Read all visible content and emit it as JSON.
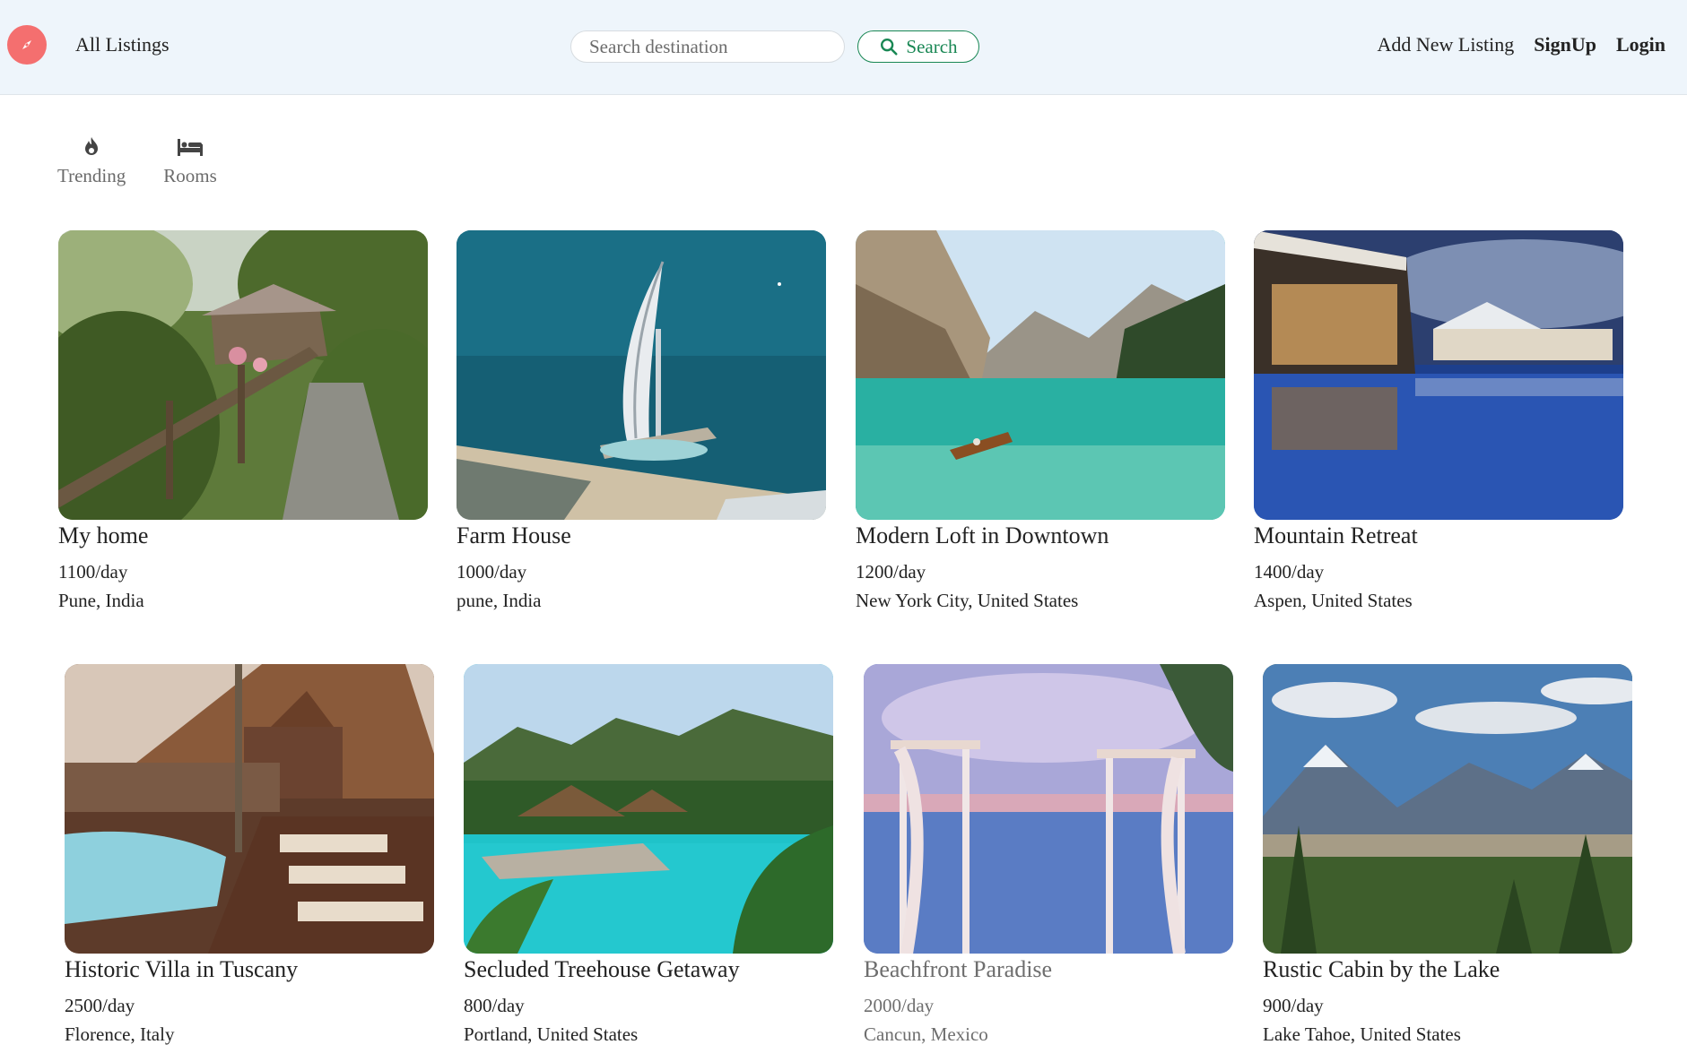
{
  "navbar": {
    "brand_icon": "compass-icon",
    "all_listings": "All Listings",
    "search_placeholder": "Search destination",
    "search_label": "Search",
    "add_listing": "Add New Listing",
    "signup": "SignUp",
    "login": "Login",
    "colors": {
      "background": "#eef5fb",
      "brand": "#f46f6f",
      "search_accent": "#198754"
    }
  },
  "filters": [
    {
      "label": "Trending",
      "icon": "fire-icon"
    },
    {
      "label": "Rooms",
      "icon": "bed-icon"
    }
  ],
  "listings": [
    {
      "title": "My home",
      "price": "1100/day",
      "location": "Pune, India",
      "image": "garden-path-cabin"
    },
    {
      "title": "Farm House",
      "price": "1000/day",
      "location": "pune, India",
      "image": "sea-tower-hotel"
    },
    {
      "title": "Modern Loft in Downtown",
      "price": "1200/day",
      "location": "New York City, United States",
      "image": "mountain-lake-boat"
    },
    {
      "title": "Mountain Retreat",
      "price": "1400/day",
      "location": "Aspen, United States",
      "image": "resort-pool-night"
    },
    {
      "title": "Historic Villa in Tuscany",
      "price": "2500/day",
      "location": "Florence, Italy",
      "image": "wooden-villa-pool"
    },
    {
      "title": "Secluded Treehouse Getaway",
      "price": "800/day",
      "location": "Portland, United States",
      "image": "tropical-pool-huts"
    },
    {
      "title": "Beachfront Paradise",
      "price": "2000/day",
      "location": "Cancun, Mexico",
      "image": "cabana-infinity-pool"
    },
    {
      "title": "Rustic Cabin by the Lake",
      "price": "900/day",
      "location": "Lake Tahoe, United States",
      "image": "mountain-valley-forest"
    }
  ]
}
